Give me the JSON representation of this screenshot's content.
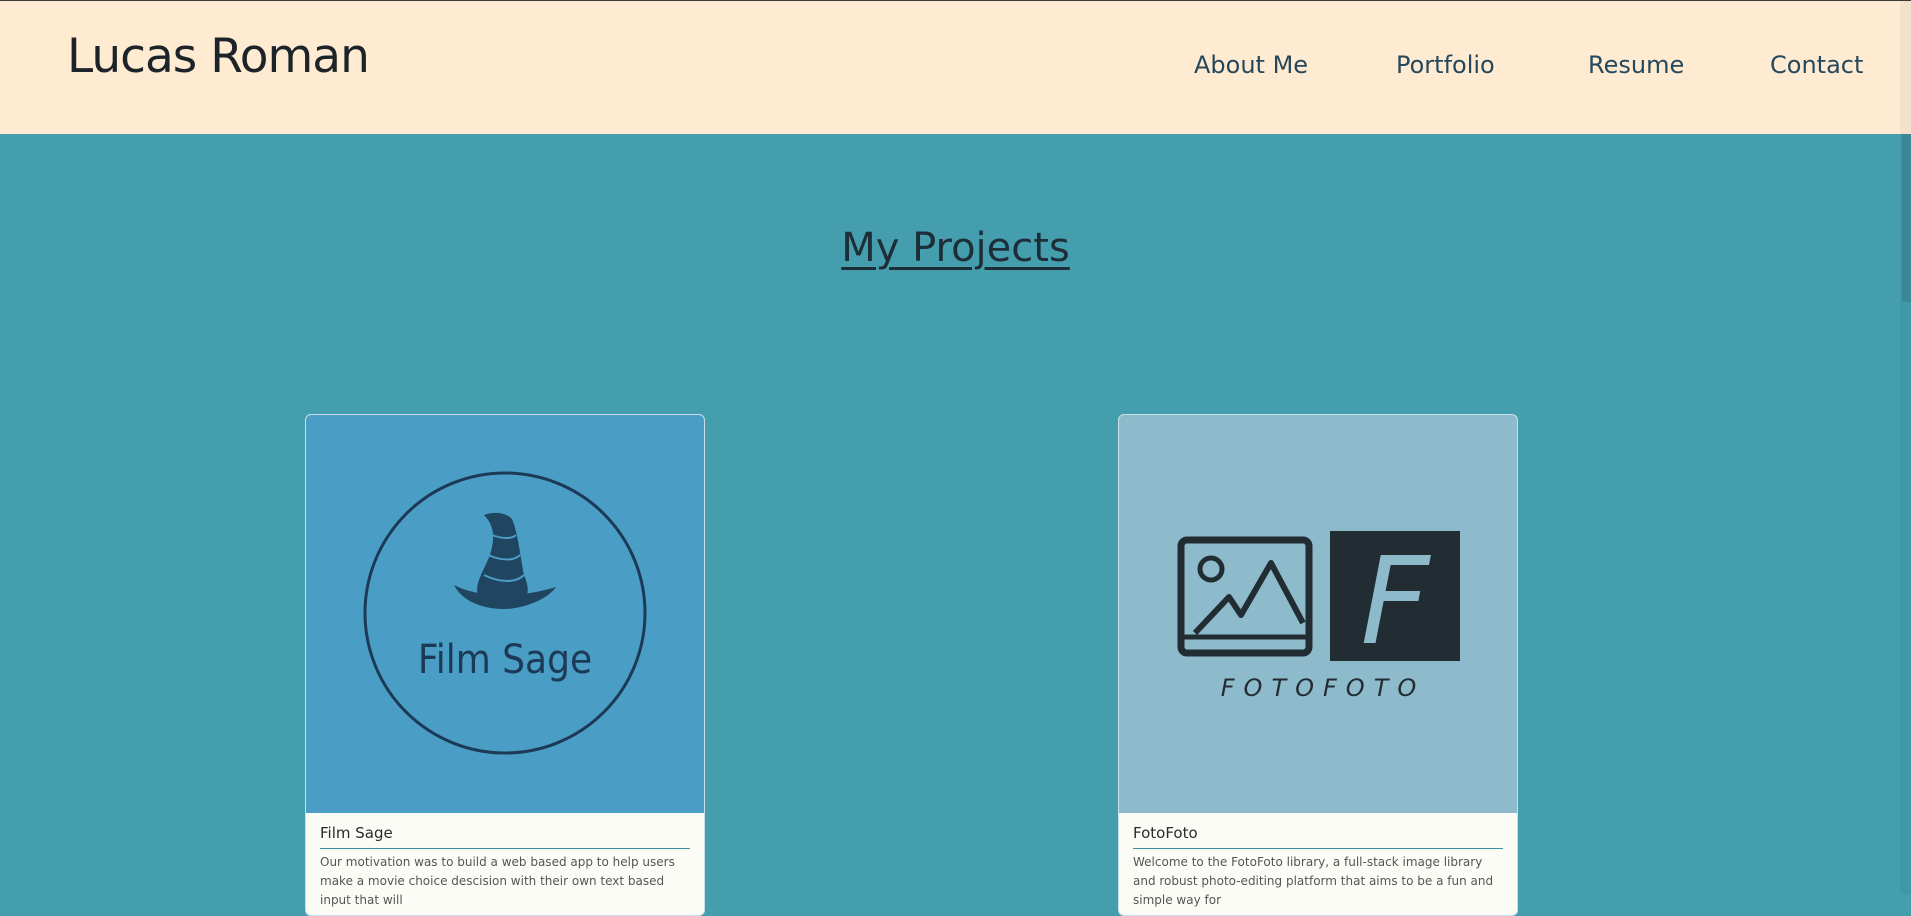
{
  "header": {
    "brand": "Lucas Roman",
    "nav": [
      "About Me",
      "Portfolio",
      "Resume",
      "Contact"
    ]
  },
  "main": {
    "title": "My Projects",
    "projects": [
      {
        "logo_text": "Film Sage",
        "title": "Film Sage",
        "description": "Our motivation was to build a web based app to help users make a movie choice descision with their own text based input that will",
        "image_bg": "#4a9dc5"
      },
      {
        "logo_text": "FOTOFOTO",
        "logo_letter": "F",
        "title": "FotoFoto",
        "description": "Welcome to the FotoFoto library, a full-stack image library and robust photo-editing platform that aims to be a fun and simple way for",
        "image_bg": "#8dbbcb"
      }
    ]
  },
  "colors": {
    "header_bg": "#feebd1",
    "page_bg": "#459eae",
    "nav_text": "#26485c",
    "dark": "#1c2a33"
  }
}
